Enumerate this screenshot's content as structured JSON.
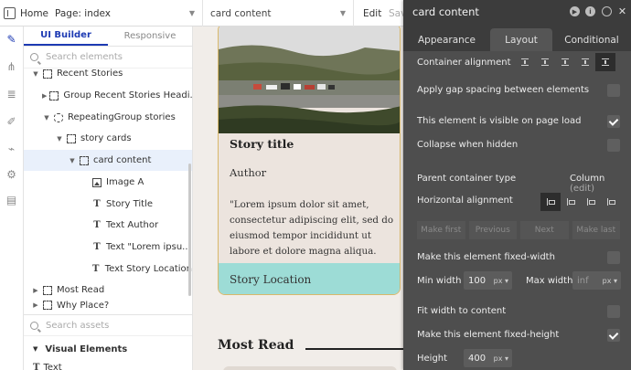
{
  "topbar": {
    "home": "Home",
    "page_selector": "Page: index",
    "element_selector": "card content",
    "edit": "Edit",
    "save": "Save"
  },
  "rail": {
    "icons": [
      "design-icon",
      "workflow-icon",
      "data-icon",
      "styles-icon",
      "plugins-icon",
      "settings-icon",
      "logs-icon"
    ]
  },
  "tree": {
    "tabs": [
      "UI Builder",
      "Responsive"
    ],
    "search_placeholder": "Search elements",
    "items": [
      {
        "label": "Recent Stories",
        "icon": "container",
        "arrow": "▼"
      },
      {
        "label": "Group Recent Stories Headi...",
        "icon": "group",
        "arrow": "▶"
      },
      {
        "label": "RepeatingGroup stories",
        "icon": "repeating-group",
        "arrow": "▼"
      },
      {
        "label": "story cards",
        "icon": "group",
        "arrow": "▼"
      },
      {
        "label": "card content",
        "icon": "group",
        "arrow": "▼"
      },
      {
        "label": "Image A",
        "icon": "image",
        "arrow": ""
      },
      {
        "label": "Story Title",
        "icon": "text",
        "arrow": ""
      },
      {
        "label": "Text Author",
        "icon": "text",
        "arrow": ""
      },
      {
        "label": "Text \"Lorem ipsu...",
        "icon": "text",
        "arrow": ""
      },
      {
        "label": "Text Story Location",
        "icon": "text",
        "arrow": ""
      },
      {
        "label": "Most Read",
        "icon": "container",
        "arrow": "▶"
      },
      {
        "label": "Why Place?",
        "icon": "container",
        "arrow": "▶"
      }
    ],
    "assets_placeholder": "Search assets",
    "visual_elements": "Visual Elements",
    "text_item": "Text"
  },
  "canvas": {
    "story_title": "Story title",
    "author": "Author",
    "lorem": "\"Lorem ipsum dolor sit amet, consectetur adipiscing elit, sed do eiusmod tempor incididunt ut labore et dolore magna aliqua.",
    "location": "Story Location",
    "section_heading": "Most Read",
    "colors": {
      "card_bg": "#ece4de",
      "location_bg": "#9ddcd6",
      "page_bg": "#f1ede9"
    }
  },
  "editor": {
    "title": "card content",
    "tabs": [
      "Appearance",
      "Layout",
      "Conditional"
    ],
    "active_tab": "Layout",
    "container_alignment": "Container alignment",
    "gap_spacing": "Apply gap spacing between elements",
    "visible_on_load": "This element is visible on page load",
    "collapse_hidden": "Collapse when hidden",
    "parent_type_label": "Parent container type",
    "parent_type_value": "Column",
    "parent_type_edit": "(edit)",
    "horizontal_alignment": "Horizontal alignment",
    "order_buttons": [
      "Make first",
      "Previous",
      "Next",
      "Make last"
    ],
    "fixed_width": "Make this element fixed-width",
    "min_width_label": "Min width",
    "min_width_value": "100",
    "min_width_unit": "px",
    "max_width_label": "Max width",
    "max_width_placeholder": "inf",
    "max_width_unit": "px",
    "fit_width": "Fit width to content",
    "fixed_height": "Make this element fixed-height",
    "height_label": "Height",
    "height_value": "400",
    "height_unit": "px",
    "checks": {
      "gap_spacing": false,
      "visible_on_load": true,
      "collapse_hidden": false,
      "fixed_width": false,
      "fit_width": false,
      "fixed_height": true
    }
  }
}
